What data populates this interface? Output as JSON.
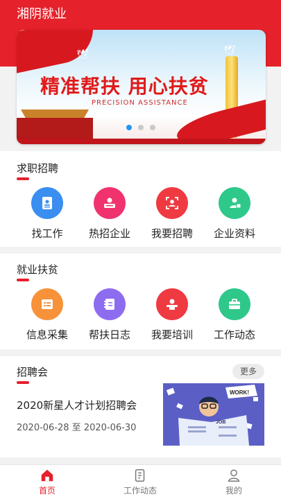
{
  "app": {
    "title": "湘阴就业"
  },
  "banner": {
    "slogan": "精准帮扶 用心扶贫",
    "slogan_en": "PRECISION ASSISTANCE",
    "dots_count": 3,
    "active_dot": 1
  },
  "sections": [
    {
      "title": "求职招聘",
      "items": [
        {
          "label": "找工作",
          "icon": "resume-icon",
          "color": "#3a8ef0"
        },
        {
          "label": "热招企业",
          "icon": "interview-icon",
          "color": "#f0336e"
        },
        {
          "label": "我要招聘",
          "icon": "recruit-icon",
          "color": "#ef3a42"
        },
        {
          "label": "企业资料",
          "icon": "company-info-icon",
          "color": "#2ec88a"
        }
      ]
    },
    {
      "title": "就业扶贫",
      "items": [
        {
          "label": "信息采集",
          "icon": "form-icon",
          "color": "#f7923a"
        },
        {
          "label": "帮扶日志",
          "icon": "notebook-icon",
          "color": "#8e6cf0"
        },
        {
          "label": "我要培训",
          "icon": "training-icon",
          "color": "#ef3a42"
        },
        {
          "label": "工作动态",
          "icon": "briefcase-icon",
          "color": "#2ec88a"
        }
      ]
    }
  ],
  "job_fair": {
    "title": "招聘会",
    "more_label": "更多",
    "event_title": "2020新星人才计划招聘会",
    "event_date": "2020-06-28 至 2020-06-30",
    "image_text_1": "WORK!",
    "image_text_2": "JOB"
  },
  "tabbar": {
    "tabs": [
      {
        "label": "首页",
        "icon": "home-icon",
        "active": true
      },
      {
        "label": "工作动态",
        "icon": "document-icon",
        "active": false
      },
      {
        "label": "我的",
        "icon": "user-icon",
        "active": false
      }
    ]
  },
  "colors": {
    "brand": "#e5212b",
    "active_dot": "#2196f3"
  }
}
